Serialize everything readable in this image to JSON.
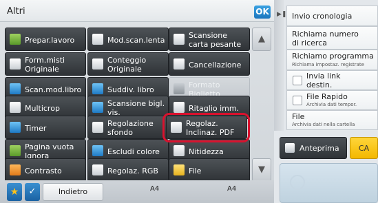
{
  "header": {
    "title": "Altri",
    "ok_label": "OK"
  },
  "buttons": [
    {
      "label": "Prepar.lavoro",
      "icon": "folder-icon",
      "enabled": true
    },
    {
      "label": "Mod.scan.lenta",
      "icon": "slow-scan-icon",
      "enabled": true
    },
    {
      "label": "Scansione carta pesante",
      "icon": "heavy-paper-icon",
      "enabled": true
    },
    {
      "label": "Form.misti Originale",
      "icon": "mixed-size-icon",
      "enabled": true
    },
    {
      "label": "Conteggio Originale",
      "icon": "count-icon",
      "enabled": true
    },
    {
      "label": "Cancellazione",
      "icon": "erase-icon",
      "enabled": true
    },
    {
      "label": "Scan.mod.libro",
      "icon": "book-icon",
      "enabled": true
    },
    {
      "label": "Suddiv. libro",
      "icon": "book-divide-icon",
      "enabled": true
    },
    {
      "label": "Formato Biglietto",
      "icon": "card-icon",
      "enabled": false
    },
    {
      "label": "Multicrop",
      "icon": "multicrop-icon",
      "enabled": true
    },
    {
      "label": "Scansione bigl. vis.",
      "icon": "card-scan-icon",
      "enabled": true
    },
    {
      "label": "Ritaglio imm.",
      "icon": "crop-icon",
      "enabled": true
    },
    {
      "label": "Timer",
      "icon": "clock-icon",
      "enabled": true
    },
    {
      "label": "Regolazione sfondo",
      "icon": "background-icon",
      "enabled": true
    },
    {
      "label": "Regolaz. Inclinaz. PDF",
      "icon": "skew-icon",
      "enabled": true
    },
    {
      "label": "Pagina vuota Ignora",
      "icon": "blank-page-icon",
      "enabled": true
    },
    {
      "label": "Escludi colore",
      "icon": "color-drop-icon",
      "enabled": true
    },
    {
      "label": "Nitidezza",
      "icon": "sharpness-icon",
      "enabled": true
    },
    {
      "label": "Contrasto",
      "icon": "contrast-icon",
      "enabled": true
    },
    {
      "label": "Regolaz. RGB",
      "icon": "rgb-icon",
      "enabled": true
    },
    {
      "label": "File",
      "icon": "file-icon",
      "enabled": true
    }
  ],
  "scroll": {
    "up_icon": "scroll-up-icon",
    "down_icon": "scroll-down-icon"
  },
  "bottom": {
    "back_label": "Indietro",
    "paper_left": "A4",
    "paper_right": "A4"
  },
  "right_panel": {
    "send_history": "Invio cronologia",
    "recall_number": "Richiama numero di ricerca",
    "recall_program": "Richiamo programma",
    "recall_program_sub": "Richiama impostaz. registrate",
    "send_link": "Invia link destin.",
    "quick_file": "File Rapido",
    "quick_file_sub": "Archivia dati tempor.",
    "file": "File",
    "file_sub": "Archivia dati nella cartella"
  },
  "actions": {
    "preview_label": "Anteprima",
    "ca_label": "CA"
  }
}
